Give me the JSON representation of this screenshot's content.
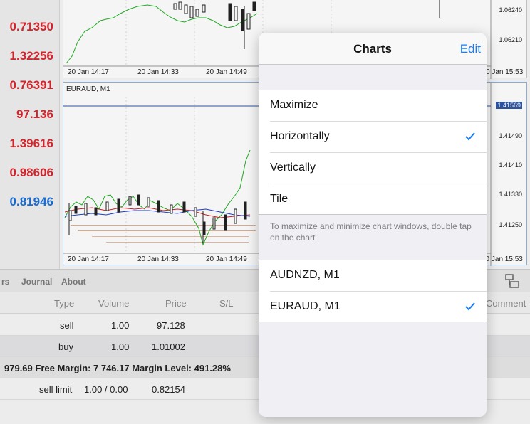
{
  "quotes": [
    {
      "value": "0.71350",
      "color": "#d9272e"
    },
    {
      "value": "1.32256",
      "color": "#d9272e"
    },
    {
      "value": "0.76391",
      "color": "#d9272e"
    },
    {
      "value": "97.136",
      "color": "#d9272e"
    },
    {
      "value": "1.39616",
      "color": "#d9272e"
    },
    {
      "value": "0.98606",
      "color": "#d9272e"
    },
    {
      "value": "0.81946",
      "color": "#1c6fd6"
    }
  ],
  "chart_top": {
    "x_ticks": [
      "20 Jan 14:17",
      "20 Jan 14:33",
      "20 Jan 14:49",
      "0 Jan 15:53"
    ],
    "y_ticks": [
      "1.06240",
      "1.06210"
    ]
  },
  "chart_bottom": {
    "title": "EURAUD, M1",
    "x_ticks": [
      "20 Jan 14:17",
      "20 Jan 14:33",
      "20 Jan 14:49",
      "20 Jan 15:53"
    ],
    "y_ticks": [
      "1.41569",
      "1.41490",
      "1.41410",
      "1.41330",
      "1.41250"
    ]
  },
  "toolbox": {
    "tabs": [
      "rs",
      "Journal",
      "About"
    ],
    "icon": "windows-arrange-icon"
  },
  "trade_table": {
    "headers": [
      "Type",
      "Volume",
      "Price",
      "S/L",
      "Comment"
    ],
    "rows": [
      {
        "type": "sell",
        "volume": "1.00",
        "price": "97.128"
      },
      {
        "type": "buy",
        "volume": "1.00",
        "price": "1.01002"
      }
    ],
    "summary": "979.69 Free Margin: 7 746.17 Margin Level: 491.28%",
    "pending": {
      "type": "sell limit",
      "volume": "1.00 / 0.00",
      "price": "0.82154"
    }
  },
  "popover": {
    "title": "Charts",
    "edit_label": "Edit",
    "layout_options": [
      {
        "label": "Maximize",
        "checked": false
      },
      {
        "label": "Horizontally",
        "checked": true
      },
      {
        "label": "Vertically",
        "checked": false
      },
      {
        "label": "Tile",
        "checked": false
      }
    ],
    "hint": "To maximize and minimize chart windows, double tap on the chart",
    "charts": [
      {
        "label": "AUDNZD, M1",
        "checked": false
      },
      {
        "label": "EURAUD, M1",
        "checked": true
      }
    ],
    "accent": "#1a7cf4"
  }
}
